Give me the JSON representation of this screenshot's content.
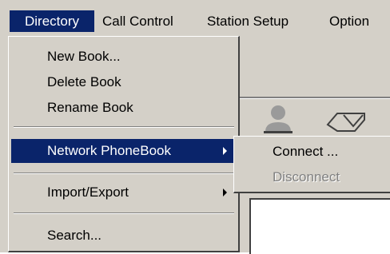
{
  "menubar": {
    "items": [
      {
        "label": "Directory",
        "selected": true
      },
      {
        "label": "Call Control"
      },
      {
        "label": "Station Setup"
      },
      {
        "label": "Option"
      }
    ]
  },
  "directory_menu": {
    "items": [
      {
        "label": "New Book..."
      },
      {
        "label": "Delete Book"
      },
      {
        "label": "Rename Book"
      },
      {
        "label": "Network PhoneBook",
        "selected": true,
        "has_submenu": true
      },
      {
        "label": "Import/Export",
        "has_submenu": true
      },
      {
        "label": "Search..."
      }
    ]
  },
  "network_submenu": {
    "items": [
      {
        "label": "Connect ...",
        "enabled": true
      },
      {
        "label": "Disconnect",
        "enabled": false
      }
    ]
  },
  "toolbar": {
    "icons": [
      "person-icon",
      "tag-icon"
    ]
  },
  "colors": {
    "face": "#d4d0c8",
    "highlight": "#0a246a",
    "disabled_text": "#808080"
  }
}
